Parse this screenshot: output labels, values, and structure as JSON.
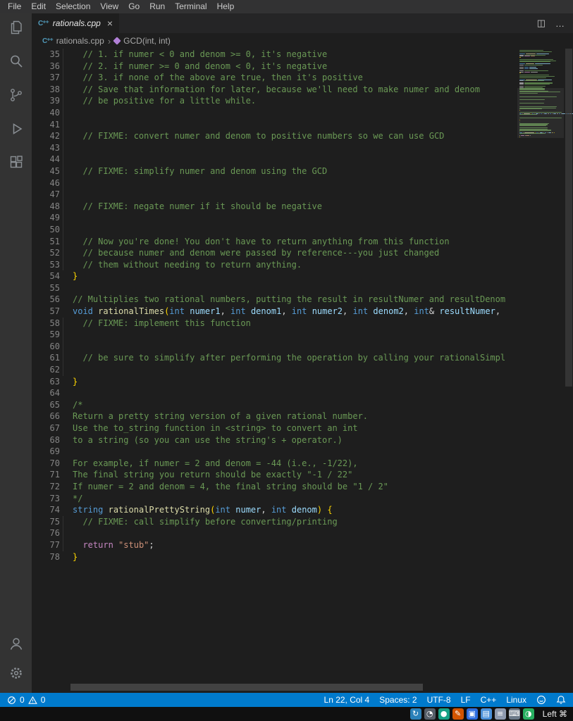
{
  "menu_bar": {
    "items": [
      "File",
      "Edit",
      "Selection",
      "View",
      "Go",
      "Run",
      "Terminal",
      "Help"
    ]
  },
  "tab": {
    "label": "rationals.cpp",
    "close_glyph": "×"
  },
  "tab_bar_actions": {
    "split_glyph": "◫",
    "more_glyph": "…"
  },
  "icons": {
    "cpp_glyph": "C⁺⁺"
  },
  "breadcrumb": {
    "file": "rationals.cpp",
    "separator": "›",
    "symbol": "GCD(int, int)"
  },
  "theme": {
    "accent": "#007acc",
    "comment": "#6a9955",
    "keyword": "#569cd6",
    "function": "#dcdcaa",
    "parameter": "#9cdcfe",
    "string": "#ce9178",
    "bracket": "#ffd700",
    "control": "#c586c1",
    "plain": "#bbbbbb"
  },
  "editor": {
    "guides": [
      [
        35,
        53
      ],
      [
        58,
        62
      ],
      [
        75,
        77
      ]
    ],
    "lines": [
      {
        "n": 35,
        "s": [
          [
            "c",
            "  // 1. if numer < 0 and denom >= 0, it's negative"
          ]
        ]
      },
      {
        "n": 36,
        "s": [
          [
            "c",
            "  // 2. if numer >= 0 and denom < 0, it's negative"
          ]
        ]
      },
      {
        "n": 37,
        "s": [
          [
            "c",
            "  // 3. if none of the above are true, then it's positive"
          ]
        ]
      },
      {
        "n": 38,
        "s": [
          [
            "c",
            "  // Save that information for later, because we'll need to make numer and denom"
          ]
        ]
      },
      {
        "n": 39,
        "s": [
          [
            "c",
            "  // be positive for a little while."
          ]
        ]
      },
      {
        "n": 40,
        "s": []
      },
      {
        "n": 41,
        "s": []
      },
      {
        "n": 42,
        "s": [
          [
            "c",
            "  // FIXME: convert numer and denom to positive numbers so we can use GCD"
          ]
        ]
      },
      {
        "n": 43,
        "s": []
      },
      {
        "n": 44,
        "s": []
      },
      {
        "n": 45,
        "s": [
          [
            "c",
            "  // FIXME: simplify numer and denom using the GCD"
          ]
        ]
      },
      {
        "n": 46,
        "s": []
      },
      {
        "n": 47,
        "s": []
      },
      {
        "n": 48,
        "s": [
          [
            "c",
            "  // FIXME: negate numer if it should be negative"
          ]
        ]
      },
      {
        "n": 49,
        "s": []
      },
      {
        "n": 50,
        "s": []
      },
      {
        "n": 51,
        "s": [
          [
            "c",
            "  // Now you're done! You don't have to return anything from this function"
          ]
        ]
      },
      {
        "n": 52,
        "s": [
          [
            "c",
            "  // because numer and denom were passed by reference---you just changed"
          ]
        ]
      },
      {
        "n": 53,
        "s": [
          [
            "c",
            "  // them without needing to return anything."
          ]
        ]
      },
      {
        "n": 54,
        "s": [
          [
            "b",
            "}"
          ]
        ]
      },
      {
        "n": 55,
        "s": []
      },
      {
        "n": 56,
        "s": [
          [
            "c",
            "// Multiplies two rational numbers, putting the result in resultNumer and resultDenom"
          ]
        ]
      },
      {
        "n": 57,
        "s": [
          [
            "k",
            "void"
          ],
          [
            "t",
            " "
          ],
          [
            "f",
            "rationalTimes"
          ],
          [
            "b",
            "("
          ],
          [
            "k",
            "int"
          ],
          [
            "t",
            " "
          ],
          [
            "p",
            "numer1"
          ],
          [
            "t",
            ", "
          ],
          [
            "k",
            "int"
          ],
          [
            "t",
            " "
          ],
          [
            "p",
            "denom1"
          ],
          [
            "t",
            ", "
          ],
          [
            "k",
            "int"
          ],
          [
            "t",
            " "
          ],
          [
            "p",
            "numer2"
          ],
          [
            "t",
            ", "
          ],
          [
            "k",
            "int"
          ],
          [
            "t",
            " "
          ],
          [
            "p",
            "denom2"
          ],
          [
            "t",
            ", "
          ],
          [
            "k",
            "int"
          ],
          [
            "t",
            "& "
          ],
          [
            "p",
            "resultNumer"
          ],
          [
            "t",
            ","
          ]
        ]
      },
      {
        "n": 58,
        "s": [
          [
            "c",
            "  // FIXME: implement this function"
          ]
        ]
      },
      {
        "n": 59,
        "s": []
      },
      {
        "n": 60,
        "s": []
      },
      {
        "n": 61,
        "s": [
          [
            "c",
            "  // be sure to simplify after performing the operation by calling your rationalSimpl"
          ]
        ]
      },
      {
        "n": 62,
        "s": []
      },
      {
        "n": 63,
        "s": [
          [
            "b",
            "}"
          ]
        ]
      },
      {
        "n": 64,
        "s": []
      },
      {
        "n": 65,
        "s": [
          [
            "c",
            "/*"
          ]
        ]
      },
      {
        "n": 66,
        "s": [
          [
            "c",
            "Return a pretty string version of a given rational number."
          ]
        ]
      },
      {
        "n": 67,
        "s": [
          [
            "c",
            "Use the to_string function in <string> to convert an int"
          ]
        ]
      },
      {
        "n": 68,
        "s": [
          [
            "c",
            "to a string (so you can use the string's + operator.)"
          ]
        ]
      },
      {
        "n": 69,
        "s": []
      },
      {
        "n": 70,
        "s": [
          [
            "c",
            "For example, if numer = 2 and denom = -44 (i.e., -1/22),"
          ]
        ]
      },
      {
        "n": 71,
        "s": [
          [
            "c",
            "The final string you return should be exactly \"-1 / 22\""
          ]
        ]
      },
      {
        "n": 72,
        "s": [
          [
            "c",
            "If numer = 2 and denom = 4, the final string should be \"1 / 2\""
          ]
        ]
      },
      {
        "n": 73,
        "s": [
          [
            "c",
            "*/"
          ]
        ]
      },
      {
        "n": 74,
        "s": [
          [
            "k",
            "string"
          ],
          [
            "t",
            " "
          ],
          [
            "f",
            "rationalPrettyString"
          ],
          [
            "b",
            "("
          ],
          [
            "k",
            "int"
          ],
          [
            "t",
            " "
          ],
          [
            "p",
            "numer"
          ],
          [
            "t",
            ", "
          ],
          [
            "k",
            "int"
          ],
          [
            "t",
            " "
          ],
          [
            "p",
            "denom"
          ],
          [
            "b",
            ")"
          ],
          [
            "t",
            " "
          ],
          [
            "b",
            "{"
          ]
        ]
      },
      {
        "n": 75,
        "s": [
          [
            "c",
            "  // FIXME: call simplify before converting/printing"
          ]
        ]
      },
      {
        "n": 76,
        "s": []
      },
      {
        "n": 77,
        "s": [
          [
            "t",
            "  "
          ],
          [
            "w",
            "return"
          ],
          [
            "t",
            " "
          ],
          [
            "s",
            "\"stub\""
          ],
          [
            "t",
            ";"
          ]
        ]
      },
      {
        "n": 78,
        "s": [
          [
            "b",
            "}"
          ]
        ]
      }
    ]
  },
  "status_bar": {
    "errors": "0",
    "warnings": "0",
    "items": [
      "Ln 22, Col 4",
      "Spaces: 2",
      "UTF-8",
      "LF",
      "C++",
      "Linux"
    ]
  },
  "taskbar": {
    "icons": [
      {
        "name": "tray-icon-sync",
        "glyph": "↻",
        "color": "#2980b9"
      },
      {
        "name": "tray-icon-clock",
        "glyph": "◔",
        "color": "#555e68"
      },
      {
        "name": "tray-icon-app",
        "glyph": "●",
        "color": "#16a085"
      },
      {
        "name": "tray-icon-edit",
        "glyph": "✎",
        "color": "#d35400"
      },
      {
        "name": "tray-icon-window-1",
        "glyph": "▣",
        "color": "#2d6cdf"
      },
      {
        "name": "tray-icon-window-2",
        "glyph": "▤",
        "color": "#4a90d9"
      },
      {
        "name": "tray-icon-notes",
        "glyph": "≡",
        "color": "#8e9aaf"
      },
      {
        "name": "tray-icon-keyboard",
        "glyph": "⌨",
        "color": "#6c7a89"
      },
      {
        "name": "tray-icon-network",
        "glyph": "◑",
        "color": "#27ae60"
      }
    ],
    "keyboard_layout": "Left ⌘"
  }
}
